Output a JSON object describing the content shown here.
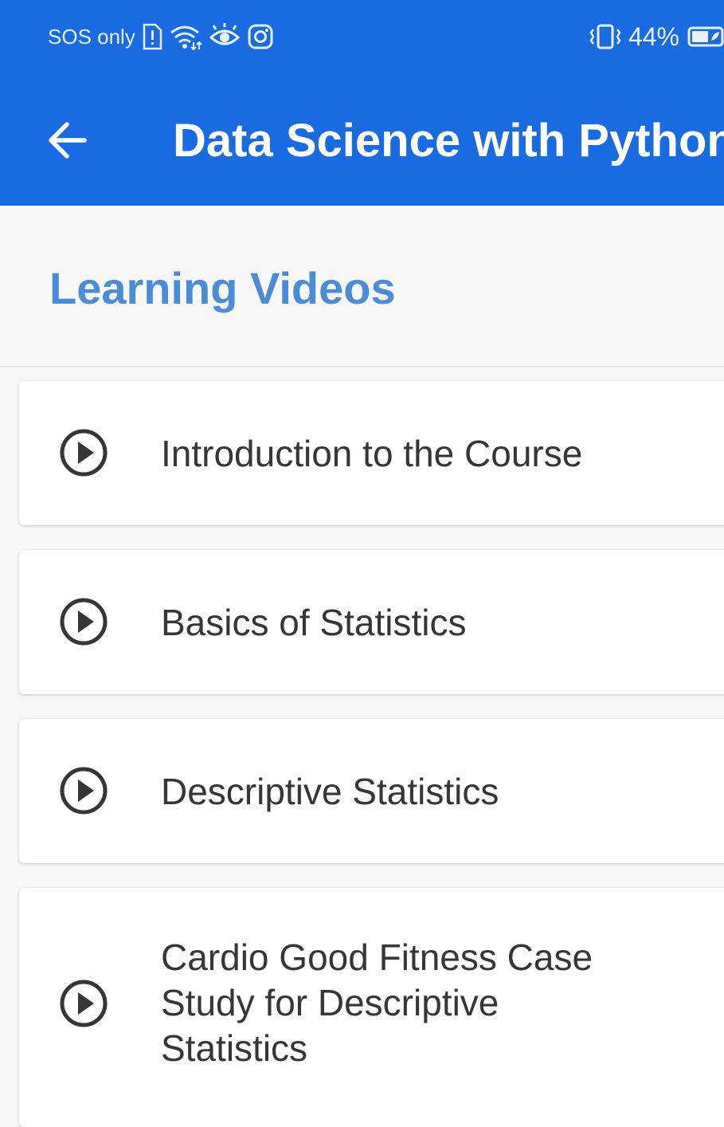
{
  "status_bar": {
    "carrier_text": "SOS only",
    "battery_percent": "44%",
    "icons": [
      "sim-alert-icon",
      "wifi-icon",
      "eye-icon",
      "instagram-icon",
      "vibrate-icon",
      "battery-icon"
    ]
  },
  "app_bar": {
    "title": "Data Science with Python",
    "back_icon": "arrow-left-icon",
    "color": "#1a6ae2"
  },
  "section": {
    "title": "Learning Videos",
    "color": "#4a8cd8"
  },
  "videos": [
    {
      "label": "Introduction to the Course",
      "icon": "play-circle-icon"
    },
    {
      "label": "Basics of Statistics",
      "icon": "play-circle-icon"
    },
    {
      "label": "Descriptive Statistics",
      "icon": "play-circle-icon"
    },
    {
      "label": "Cardio Good Fitness Case Study for Descriptive Statistics",
      "icon": "play-circle-icon"
    }
  ]
}
